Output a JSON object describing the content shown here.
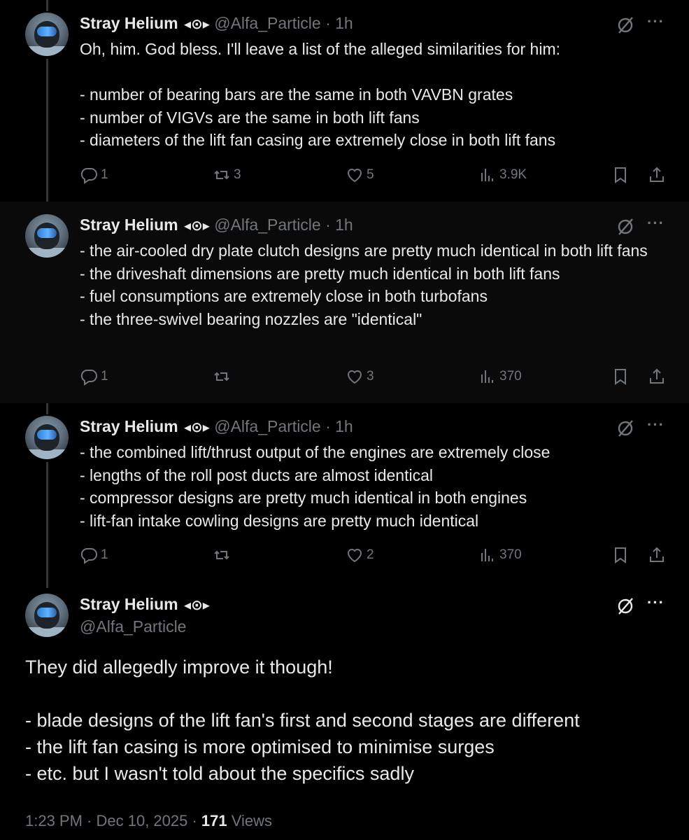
{
  "author": {
    "name": "Stray Helium",
    "badge": "◂⊙▸",
    "handle": "@Alfa_Particle"
  },
  "replies": [
    {
      "time": "· 1h",
      "text": "Oh, him. God bless. I'll leave a list of the alleged similarities for him:\n\n- number of bearing bars are the same in both VAVBN grates\n- number of VIGVs are the same in both lift fans\n- diameters of the lift fan casing are extremely close in both lift fans",
      "replies": "1",
      "reposts": "3",
      "likes": "5",
      "views": "3.9K"
    },
    {
      "time": "· 1h",
      "text": "- the air-cooled dry plate clutch designs are pretty much identical in both lift fans\n- the driveshaft dimensions are pretty much identical in both lift fans\n- fuel consumptions are extremely close in both turbofans\n- the three-swivel bearing nozzles are \"identical\"",
      "replies": "1",
      "reposts": "",
      "likes": "3",
      "views": "370"
    },
    {
      "time": "· 1h",
      "text": "- the combined lift/thrust output of the engines are extremely close\n- lengths of the roll post ducts are almost identical\n- compressor designs are pretty much identical in both engines\n- lift-fan intake cowling designs are pretty much identical",
      "replies": "1",
      "reposts": "",
      "likes": "2",
      "views": "370"
    }
  ],
  "main": {
    "text": "They did allegedly improve it though!\n\n- blade designs of the lift fan's first and second stages are different\n- the lift fan casing is more optimised to minimise surges\n- etc. but I wasn't told about the specifics sadly",
    "timestamp": "1:23 PM · Dec 10, 2025 · ",
    "views_count": "171",
    "views_label": " Views"
  },
  "icons": {
    "reply": "reply-icon",
    "repost": "repost-icon",
    "like": "heart-icon",
    "views": "views-icon",
    "bookmark": "bookmark-icon",
    "share": "share-icon",
    "grok": "grok-icon",
    "more": "more-icon"
  }
}
